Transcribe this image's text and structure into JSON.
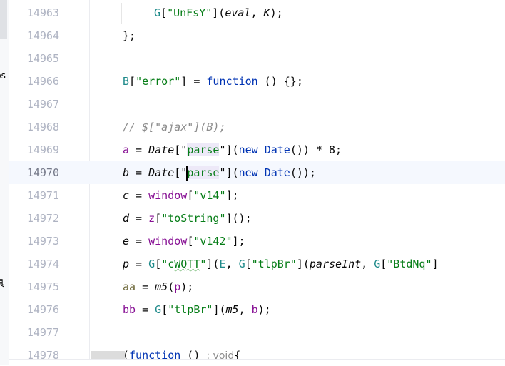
{
  "left_panel": {
    "labels": [
      "ps",
      "具"
    ]
  },
  "editor": {
    "current_line": 14970,
    "lines": [
      {
        "num": "14963",
        "indent": 1,
        "tokens": [
          [
            "G",
            "glob"
          ],
          [
            "[",
            ""
          ],
          [
            "\"UnFsY\"",
            "str"
          ],
          [
            "](",
            ""
          ],
          [
            "eval",
            "ital"
          ],
          [
            ", ",
            ""
          ],
          [
            "K",
            "ital"
          ],
          [
            ");",
            ""
          ]
        ]
      },
      {
        "num": "14964",
        "indent": 0,
        "tokens": [
          [
            "};",
            ""
          ]
        ]
      },
      {
        "num": "14965",
        "indent": 0,
        "tokens": []
      },
      {
        "num": "14966",
        "indent": 0,
        "tokens": [
          [
            "B",
            "glob"
          ],
          [
            "[",
            ""
          ],
          [
            "\"error\"",
            "str"
          ],
          [
            "] = ",
            ""
          ],
          [
            "function",
            "kw"
          ],
          [
            " () {};",
            ""
          ]
        ]
      },
      {
        "num": "14967",
        "indent": 0,
        "tokens": []
      },
      {
        "num": "14968",
        "indent": 0,
        "tokens": [
          [
            "// $[\"ajax\"](B);",
            "com"
          ]
        ]
      },
      {
        "num": "14969",
        "indent": 0,
        "tokens": [
          [
            "a",
            "var"
          ],
          [
            " = ",
            ""
          ],
          [
            "Date",
            "ital"
          ],
          [
            "[\"",
            ""
          ],
          [
            "parse",
            "str hl"
          ],
          [
            "\"](",
            ""
          ],
          [
            "new",
            "kw"
          ],
          [
            " ",
            ""
          ],
          [
            "Date",
            "kw"
          ],
          [
            "()) * 8;",
            ""
          ]
        ]
      },
      {
        "num": "14970",
        "indent": 0,
        "caret": true,
        "tokens": [
          [
            "b",
            "loc"
          ],
          [
            " = ",
            ""
          ],
          [
            "Date",
            "ital"
          ],
          [
            "[\"",
            ""
          ],
          [
            "parse",
            "str hl caret"
          ],
          [
            "\"](",
            ""
          ],
          [
            "new",
            "kw"
          ],
          [
            " ",
            ""
          ],
          [
            "Date",
            "kw"
          ],
          [
            "());",
            ""
          ]
        ]
      },
      {
        "num": "14971",
        "indent": 0,
        "tokens": [
          [
            "c",
            "loc"
          ],
          [
            " = ",
            ""
          ],
          [
            "window",
            "var"
          ],
          [
            "[",
            ""
          ],
          [
            "\"v14\"",
            "str"
          ],
          [
            "];",
            ""
          ]
        ]
      },
      {
        "num": "14972",
        "indent": 0,
        "tokens": [
          [
            "d",
            "loc"
          ],
          [
            " = ",
            ""
          ],
          [
            "z",
            "var"
          ],
          [
            "[",
            ""
          ],
          [
            "\"toString\"",
            "str"
          ],
          [
            "]();",
            ""
          ]
        ]
      },
      {
        "num": "14973",
        "indent": 0,
        "tokens": [
          [
            "e",
            "loc"
          ],
          [
            " = ",
            ""
          ],
          [
            "window",
            "var"
          ],
          [
            "[",
            ""
          ],
          [
            "\"v142\"",
            "str"
          ],
          [
            "];",
            ""
          ]
        ]
      },
      {
        "num": "14974",
        "indent": 0,
        "tokens": [
          [
            "p",
            "loc"
          ],
          [
            " = ",
            ""
          ],
          [
            "G",
            "glob"
          ],
          [
            "[",
            ""
          ],
          [
            "\"c",
            "str"
          ],
          [
            "WQTT",
            "str warn"
          ],
          [
            "\"",
            "str"
          ],
          [
            "](",
            ""
          ],
          [
            "E",
            "glob"
          ],
          [
            ", ",
            ""
          ],
          [
            "G",
            "glob"
          ],
          [
            "[",
            ""
          ],
          [
            "\"tlpBr\"",
            "str"
          ],
          [
            "](",
            ""
          ],
          [
            "parseInt",
            "ital"
          ],
          [
            ", ",
            ""
          ],
          [
            "G",
            "glob"
          ],
          [
            "[",
            ""
          ],
          [
            "\"BtdNq\"",
            "str"
          ],
          [
            "]",
            ""
          ]
        ]
      },
      {
        "num": "14975",
        "indent": 0,
        "tokens": [
          [
            "aa",
            "olive"
          ],
          [
            " = ",
            ""
          ],
          [
            "m5",
            "ital"
          ],
          [
            "(",
            ""
          ],
          [
            "p",
            "var"
          ],
          [
            ");",
            ""
          ]
        ]
      },
      {
        "num": "14976",
        "indent": 0,
        "tokens": [
          [
            "bb",
            "var"
          ],
          [
            " = ",
            ""
          ],
          [
            "G",
            "glob"
          ],
          [
            "[",
            ""
          ],
          [
            "\"tlpBr\"",
            "str"
          ],
          [
            "](",
            ""
          ],
          [
            "m5",
            "ital"
          ],
          [
            ", ",
            ""
          ],
          [
            "b",
            "var"
          ],
          [
            ");",
            ""
          ]
        ]
      },
      {
        "num": "14977",
        "indent": 0,
        "tokens": []
      },
      {
        "num": "14978",
        "indent": 0,
        "tokens": [
          [
            "(",
            ""
          ],
          [
            "function",
            "kw"
          ],
          [
            " () ",
            ""
          ],
          [
            ": void",
            "hint"
          ],
          [
            "{",
            ""
          ]
        ]
      }
    ]
  }
}
